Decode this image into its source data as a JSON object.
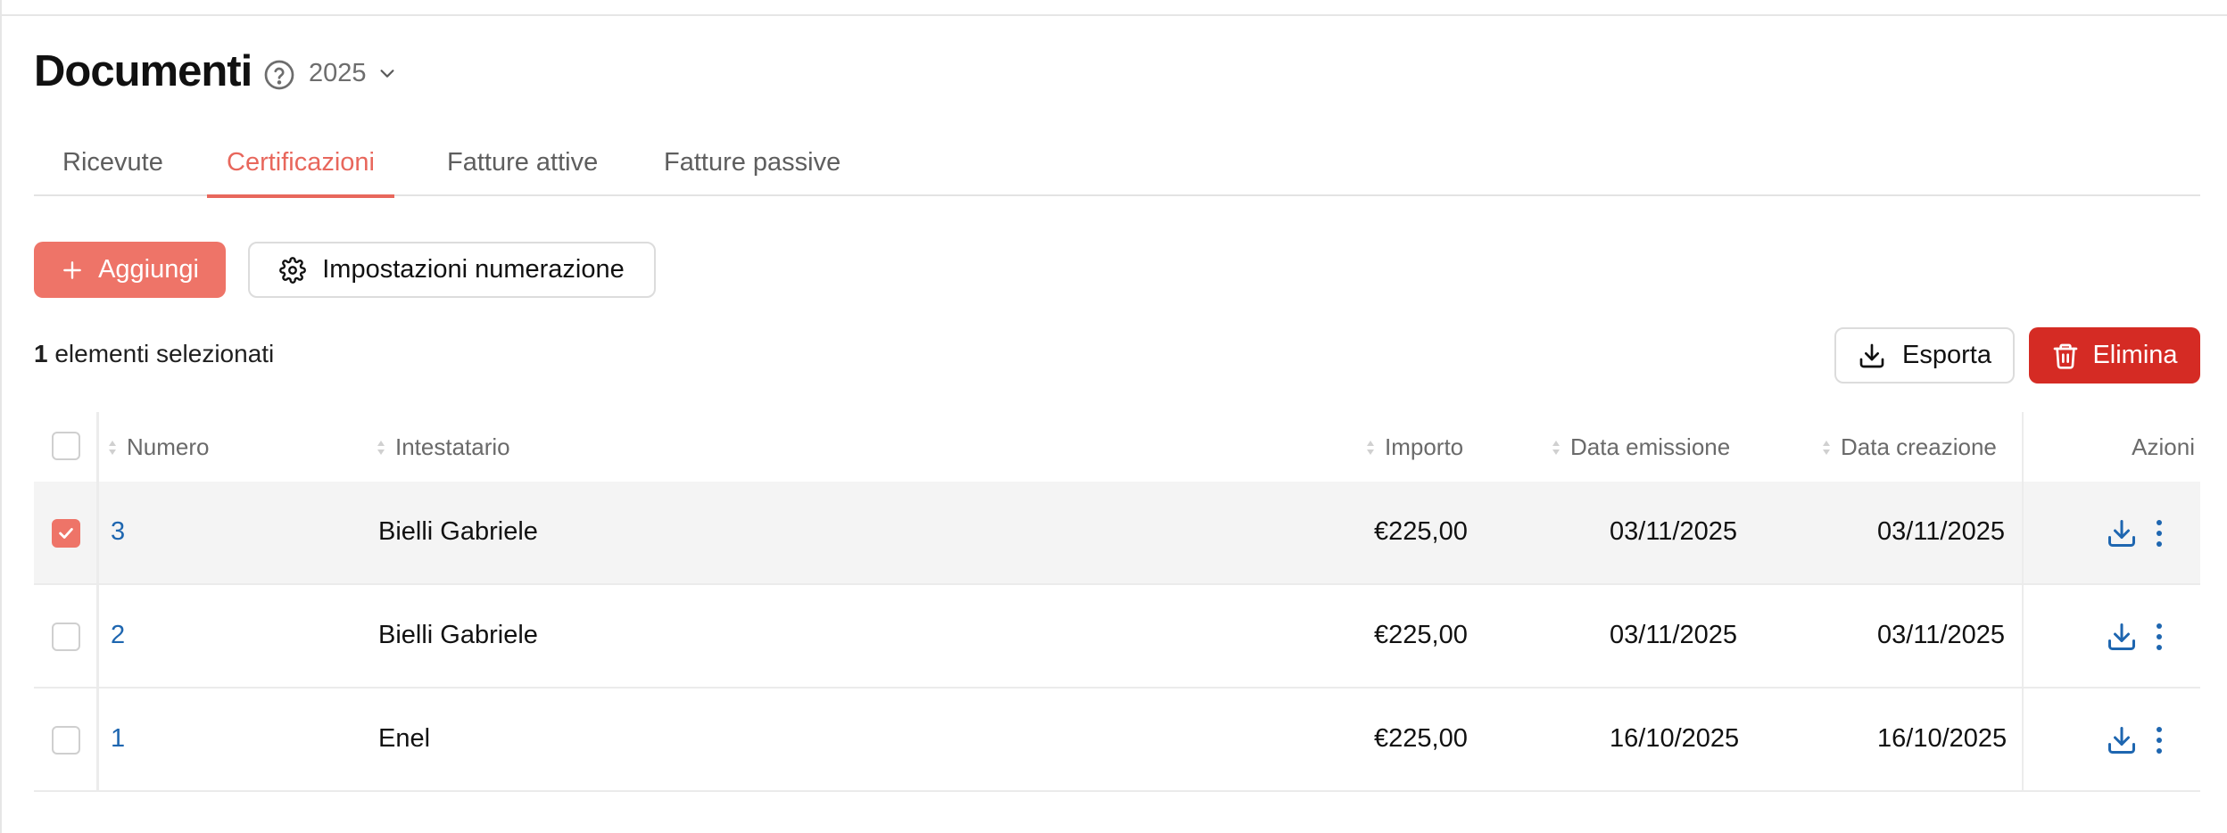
{
  "header": {
    "title": "Documenti",
    "year": "2025"
  },
  "tabs": [
    {
      "label": "Ricevute",
      "active": false
    },
    {
      "label": "Certificazioni",
      "active": true
    },
    {
      "label": "Fatture attive",
      "active": false
    },
    {
      "label": "Fatture passive",
      "active": false
    }
  ],
  "toolbar": {
    "add_label": "Aggiungi",
    "numbering_label": "Impostazioni numerazione",
    "export_label": "Esporta",
    "delete_label": "Elimina"
  },
  "selection": {
    "count": "1",
    "text": "elementi selezionati"
  },
  "table": {
    "columns": [
      "Numero",
      "Intestatario",
      "Importo",
      "Data emissione",
      "Data creazione",
      "Azioni"
    ],
    "rows": [
      {
        "numero": "3",
        "intestatario": "Bielli Gabriele",
        "importo": "€225,00",
        "data_emissione": "03/11/2025",
        "data_creazione": "03/11/2025",
        "selected": true
      },
      {
        "numero": "2",
        "intestatario": "Bielli Gabriele",
        "importo": "€225,00",
        "data_emissione": "03/11/2025",
        "data_creazione": "03/11/2025",
        "selected": false
      },
      {
        "numero": "1",
        "intestatario": "Enel",
        "importo": "€225,00",
        "data_emissione": "16/10/2025",
        "data_creazione": "16/10/2025",
        "selected": false
      }
    ]
  },
  "icons": {
    "help": "question-circle-icon",
    "year_dropdown": "chevron-down-icon",
    "add": "plus-icon",
    "settings": "gear-icon",
    "export": "download-icon",
    "delete": "trash-icon",
    "sort": "sort-icon",
    "row_download": "download-icon",
    "row_menu": "more-vertical-icon"
  },
  "colors": {
    "accent": "#ee7468",
    "tab_active": "#e8675c",
    "danger": "#d52b24",
    "link": "#1e66b0"
  }
}
